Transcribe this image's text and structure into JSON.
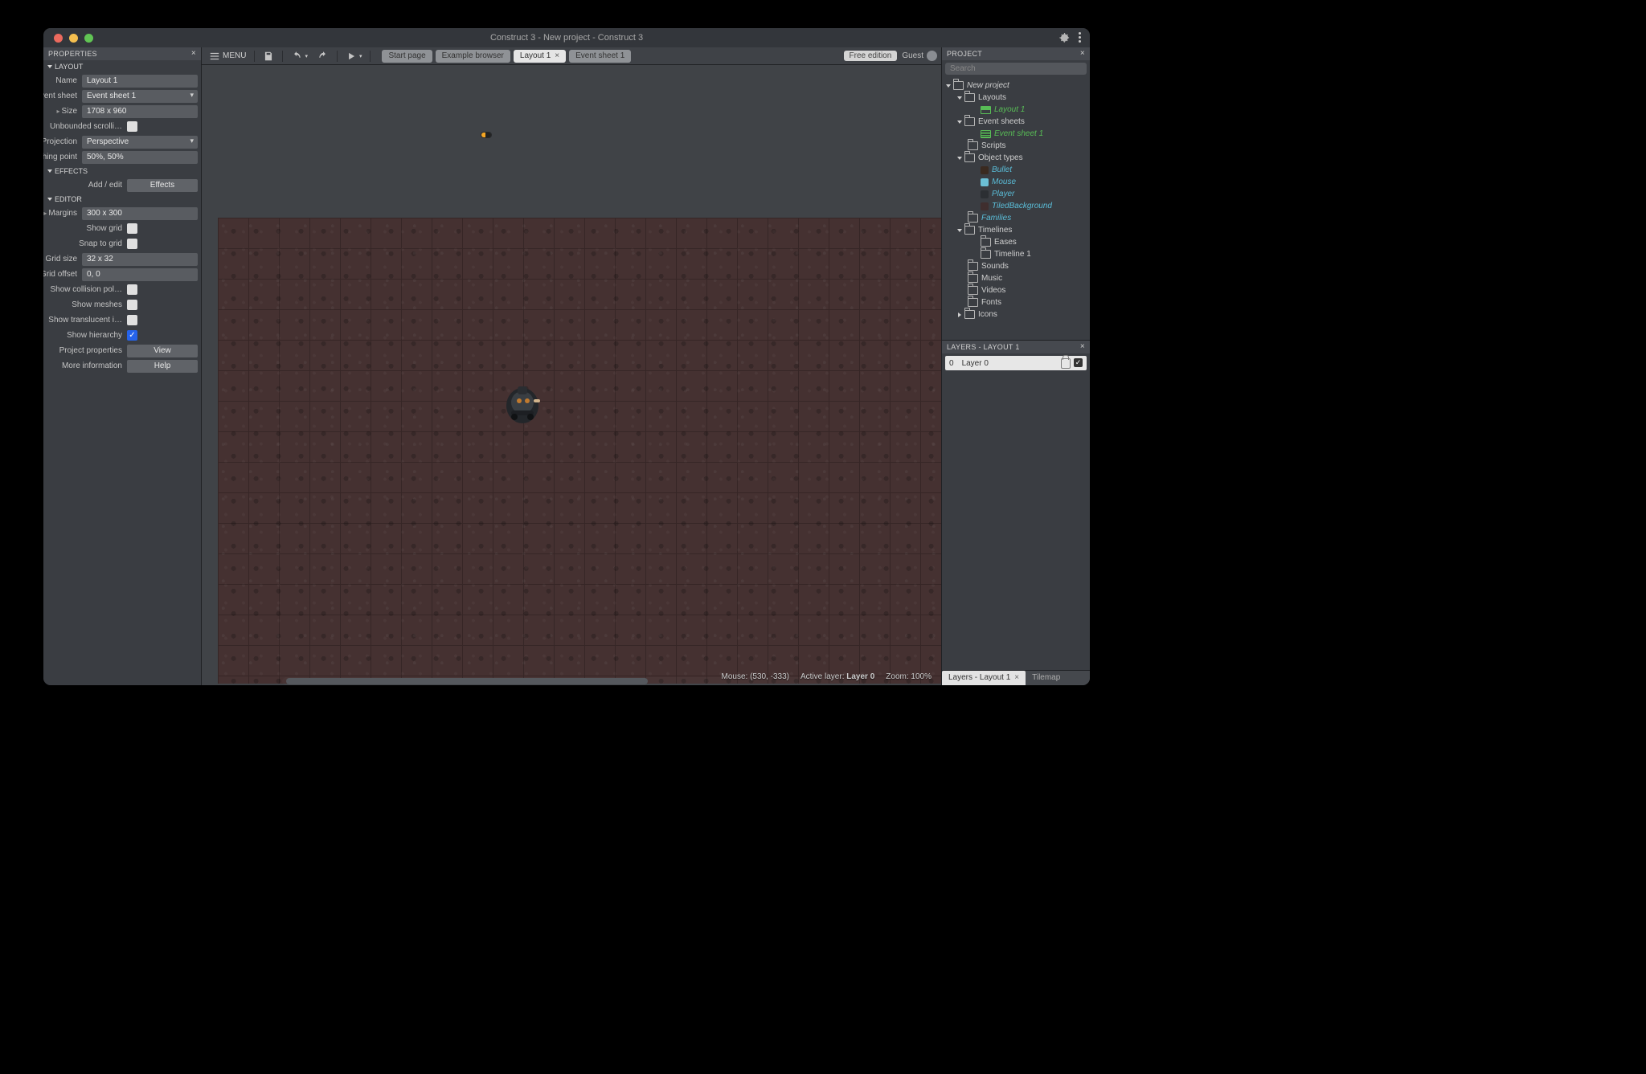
{
  "title": "Construct 3 - New project - Construct 3",
  "menu_label": "MENU",
  "tabs": [
    {
      "label": "Start page",
      "active": false,
      "closable": false
    },
    {
      "label": "Example browser",
      "active": false,
      "closable": false
    },
    {
      "label": "Layout 1",
      "active": true,
      "closable": true
    },
    {
      "label": "Event sheet 1",
      "active": false,
      "closable": false
    }
  ],
  "free_edition": "Free edition",
  "guest_label": "Guest",
  "properties": {
    "title": "PROPERTIES",
    "groups": {
      "layout": {
        "title": "LAYOUT",
        "name_label": "Name",
        "name_value": "Layout 1",
        "eventsheet_label": "Event sheet",
        "eventsheet_value": "Event sheet 1",
        "size_label": "Size",
        "size_value": "1708 x 960",
        "unbounded_label": "Unbounded scrolli…",
        "unbounded": false,
        "projection_label": "Projection",
        "projection_value": "Perspective",
        "vanishing_label": "Vanishing point",
        "vanishing_value": "50%, 50%"
      },
      "effects": {
        "title": "EFFECTS",
        "addedit_label": "Add / edit",
        "addedit_btn": "Effects"
      },
      "editor": {
        "title": "EDITOR",
        "margins_label": "Margins",
        "margins_value": "300 x 300",
        "showgrid_label": "Show grid",
        "showgrid": false,
        "snapgrid_label": "Snap to grid",
        "snapgrid": false,
        "gridsize_label": "Grid size",
        "gridsize_value": "32 x 32",
        "gridoffset_label": "Grid offset",
        "gridoffset_value": "0, 0",
        "collision_label": "Show collision pol…",
        "collision": false,
        "meshes_label": "Show meshes",
        "meshes": false,
        "translucent_label": "Show translucent i…",
        "translucent": false,
        "hierarchy_label": "Show hierarchy",
        "hierarchy": true,
        "projprops_label": "Project properties",
        "projprops_btn": "View",
        "moreinfo_label": "More information",
        "moreinfo_btn": "Help"
      }
    }
  },
  "canvas": {
    "mouse_label": "Mouse: (530, -333)",
    "layer_label": "Active layer: ",
    "layer_value": "Layer 0",
    "zoom_label": "Zoom: 100%"
  },
  "project": {
    "title": "PROJECT",
    "search_placeholder": "Search",
    "tree": [
      {
        "lv": 1,
        "icon": "folder",
        "label": "New project",
        "italic": true,
        "expand": "open"
      },
      {
        "lv": 2,
        "icon": "folder",
        "label": "Layouts",
        "expand": "open"
      },
      {
        "lv": 3,
        "icon": "layout",
        "label": "Layout 1",
        "class": "col-green italic"
      },
      {
        "lv": 2,
        "icon": "folder",
        "label": "Event sheets",
        "expand": "open"
      },
      {
        "lv": 3,
        "icon": "sheet",
        "label": "Event sheet 1",
        "class": "col-green italic"
      },
      {
        "lv": 2,
        "icon": "folder",
        "label": "Scripts",
        "expand": "none"
      },
      {
        "lv": 2,
        "icon": "folder",
        "label": "Object types",
        "expand": "open"
      },
      {
        "lv": 3,
        "icon": "sq",
        "sq": "#3a2a20",
        "label": "Bullet",
        "class": "col-cyan italic"
      },
      {
        "lv": 3,
        "icon": "sq",
        "sq": "#6cc0d6",
        "label": "Mouse",
        "class": "col-cyan italic"
      },
      {
        "lv": 3,
        "icon": "sq",
        "sq": "#2c2f33",
        "label": "Player",
        "class": "col-cyan italic"
      },
      {
        "lv": 3,
        "icon": "sq",
        "sq": "#3f2e2e",
        "label": "TiledBackground",
        "class": "col-cyan italic"
      },
      {
        "lv": 2,
        "icon": "folder",
        "label": "Families",
        "class": "col-cyan italic",
        "expand": "none"
      },
      {
        "lv": 2,
        "icon": "folder",
        "label": "Timelines",
        "expand": "open"
      },
      {
        "lv": 3,
        "icon": "folder",
        "label": "Eases",
        "expand": "none"
      },
      {
        "lv": 3,
        "icon": "folder",
        "label": "Timeline 1",
        "expand": "none"
      },
      {
        "lv": 2,
        "icon": "folder",
        "label": "Sounds",
        "expand": "none"
      },
      {
        "lv": 2,
        "icon": "folder",
        "label": "Music",
        "expand": "none"
      },
      {
        "lv": 2,
        "icon": "folder",
        "label": "Videos",
        "expand": "none"
      },
      {
        "lv": 2,
        "icon": "folder",
        "label": "Fonts",
        "expand": "none"
      },
      {
        "lv": 2,
        "icon": "folder",
        "label": "Icons",
        "expand": "closed"
      }
    ]
  },
  "layers": {
    "title": "LAYERS - LAYOUT 1",
    "index": "0",
    "name": "Layer 0",
    "tabs": [
      {
        "label": "Layers - Layout 1",
        "active": true,
        "closable": true
      },
      {
        "label": "Tilemap",
        "active": false
      }
    ]
  }
}
